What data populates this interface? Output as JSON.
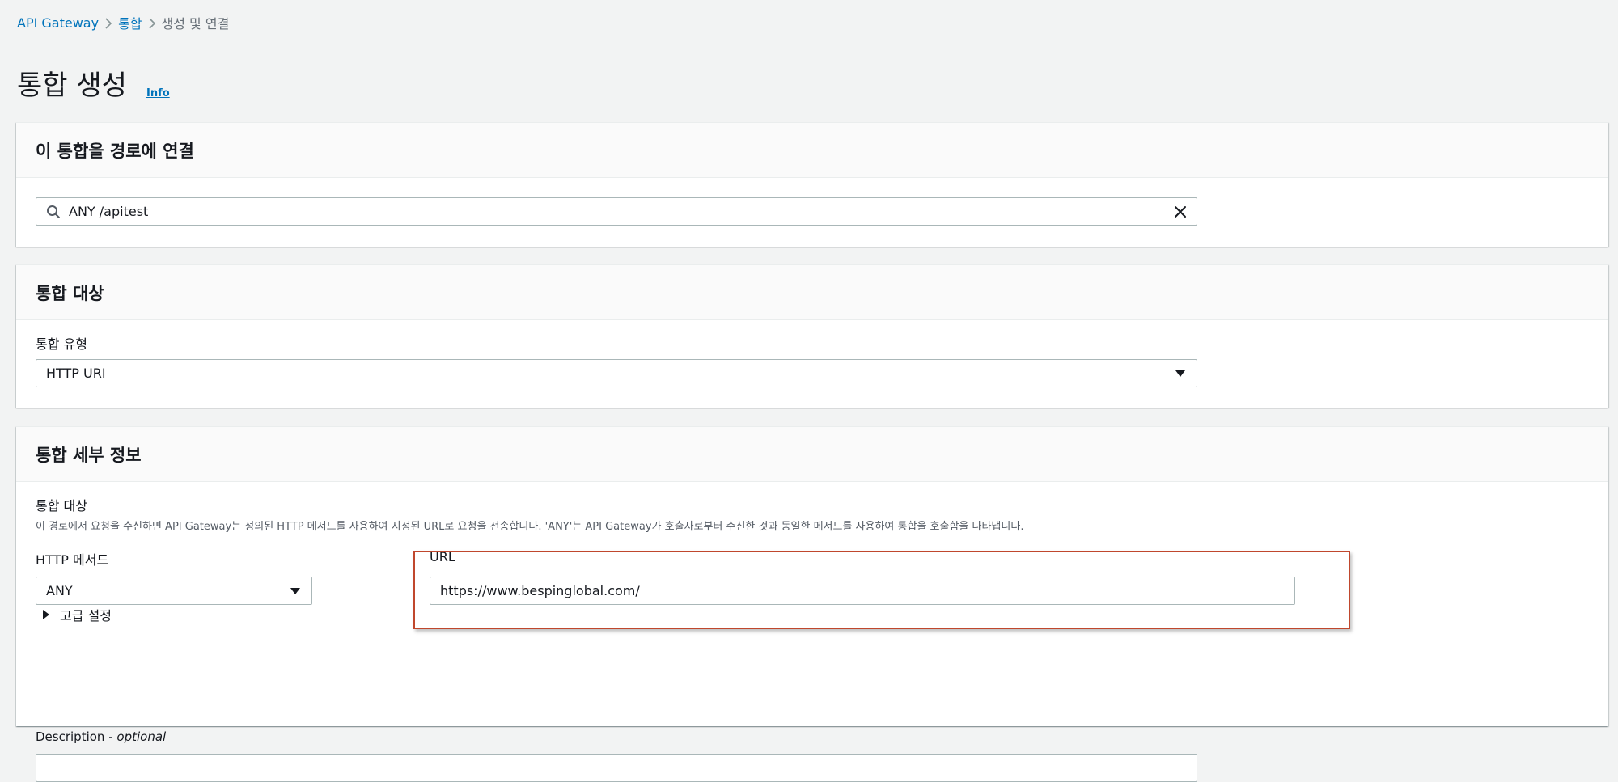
{
  "breadcrumb": {
    "items": [
      "API Gateway",
      "통합"
    ],
    "current": "생성 및 연결"
  },
  "page": {
    "title": "통합 생성",
    "info": "Info"
  },
  "section_route": {
    "title": "이 통합을 경로에 연결",
    "route_value": "ANY /apitest"
  },
  "section_target": {
    "title": "통합 대상",
    "type_label": "통합 유형",
    "type_value": "HTTP URI"
  },
  "section_details": {
    "title": "통합 세부 정보",
    "target_label": "통합 대상",
    "target_desc": "이 경로에서 요청을 수신하면 API Gateway는 정의된 HTTP 메서드를 사용하여 지정된 URL로 요청을 전송합니다. 'ANY'는 API Gateway가 호출자로부터 수신한 것과 동일한 메서드를 사용하여 통합을 호출함을 나타냅니다.",
    "method_label": "HTTP 메서드",
    "method_value": "ANY",
    "url_label": "URL",
    "url_value": "https://www.bespinglobal.com/",
    "advanced_label": "고급 설정",
    "description_label": "Description",
    "description_sep": " - ",
    "description_optional": "optional"
  },
  "colors": {
    "link": "#0073bb",
    "highlight": "#c0472d",
    "background": "#f2f3f3"
  },
  "icons": [
    "chevron-right-icon",
    "search-icon",
    "clear-icon",
    "dropdown-caret-icon",
    "expand-caret-icon"
  ]
}
